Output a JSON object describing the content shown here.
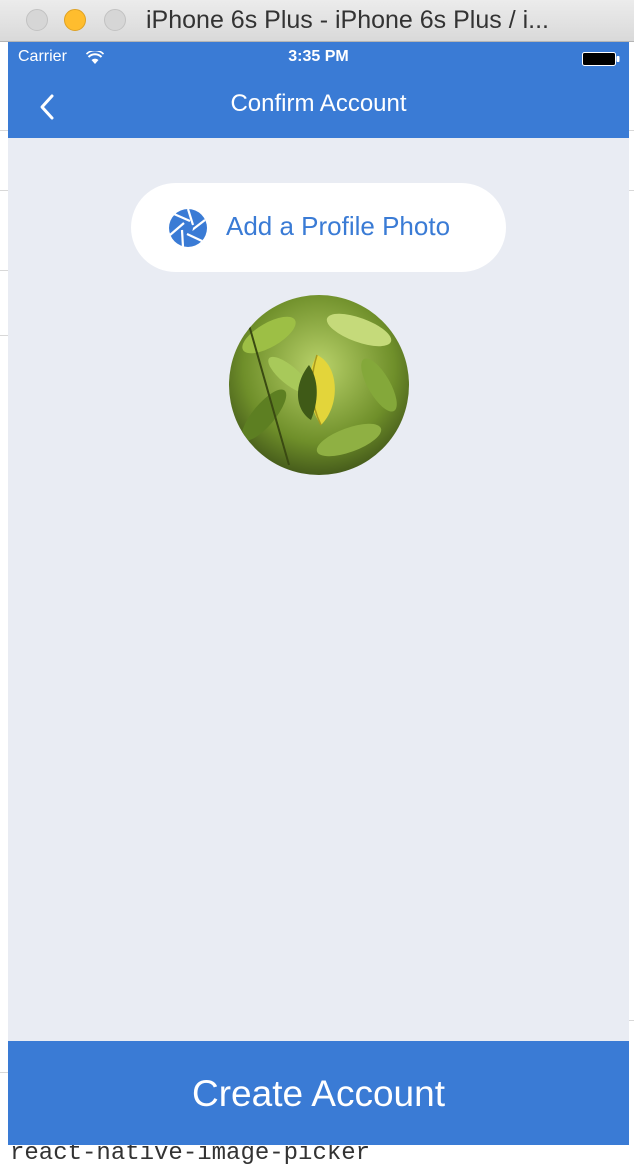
{
  "window": {
    "title": "iPhone 6s Plus - iPhone 6s Plus / i..."
  },
  "status_bar": {
    "carrier": "Carrier",
    "time": "3:35 PM"
  },
  "nav": {
    "title": "Confirm Account",
    "back_icon": "chevron-left-icon"
  },
  "profile": {
    "add_photo_label": "Add a Profile Photo",
    "photo_icon": "camera-aperture-icon",
    "avatar": "leaf photo"
  },
  "footer": {
    "create_label": "Create Account"
  },
  "background_editor": {
    "bottom_line": "react-native-image-picker"
  },
  "colors": {
    "brand": "#3a7bd5",
    "screen_bg": "#e9ecf3"
  }
}
